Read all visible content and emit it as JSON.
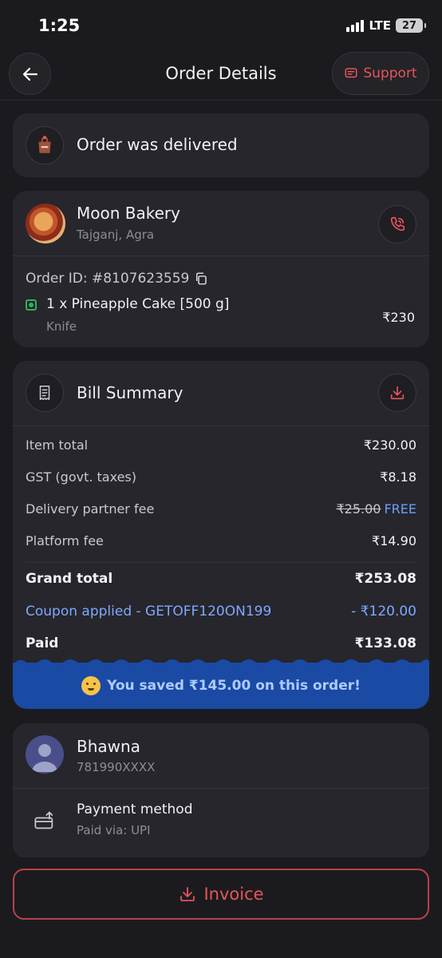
{
  "status_bar": {
    "time": "1:25",
    "network": "LTE",
    "battery": "27"
  },
  "header": {
    "title": "Order Details",
    "support_label": "Support"
  },
  "delivery": {
    "status": "Order was delivered"
  },
  "restaurant": {
    "name": "Moon Bakery",
    "location": "Tajganj, Agra",
    "order_id": "Order ID: #8107623559",
    "items": [
      {
        "name": "1 x Pineapple Cake [500 g]",
        "addon": "Knife",
        "price": "₹230"
      }
    ]
  },
  "bill": {
    "title": "Bill Summary",
    "rows": [
      {
        "label": "Item total",
        "value": "₹230.00"
      },
      {
        "label": "GST (govt. taxes)",
        "value": "₹8.18"
      },
      {
        "label": "Delivery partner fee",
        "value_strike": "₹25.00",
        "value": "FREE"
      },
      {
        "label": "Platform fee",
        "value": "₹14.90"
      }
    ],
    "grand_total": {
      "label": "Grand total",
      "value": "₹253.08"
    },
    "coupon": {
      "label": "Coupon applied - GETOFF120ON199",
      "value": "- ₹120.00"
    },
    "paid": {
      "label": "Paid",
      "value": "₹133.08"
    },
    "saved_message": "You saved ₹145.00 on this order!"
  },
  "customer": {
    "name": "Bhawna",
    "phone": "781990XXXX",
    "payment_title": "Payment method",
    "payment_detail": "Paid via: UPI"
  },
  "footer": {
    "invoice_label": "Invoice"
  },
  "colors": {
    "accent_red": "#e8545a",
    "coupon_blue": "#7fa8ff",
    "banner_blue": "#1a4aa3",
    "veg_green": "#2db35d"
  }
}
